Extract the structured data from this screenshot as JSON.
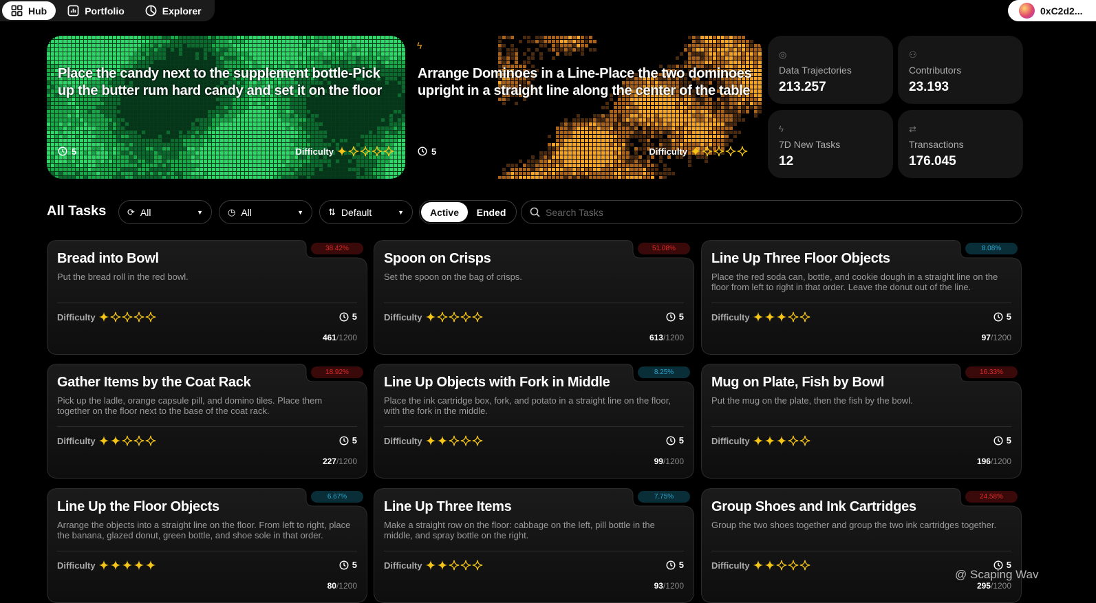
{
  "nav": {
    "tabs": [
      {
        "label": "Hub",
        "active": true
      },
      {
        "label": "Portfolio",
        "active": false
      },
      {
        "label": "Explorer",
        "active": false
      }
    ]
  },
  "wallet": {
    "address": "0xC2d2..."
  },
  "featured": [
    {
      "title": "Place the candy next to the supplement bottle-Pick up the butter rum hard candy and set it on the floor",
      "steps": "5",
      "difficulty_label": "Difficulty",
      "difficulty": 1,
      "accent": "#1ec85a"
    },
    {
      "title": "Arrange Dominoes in a Line-Place the two dominoes upright in a straight line along the center of the table",
      "steps": "5",
      "difficulty_label": "Difficulty",
      "difficulty": 1,
      "accent": "#f0a21e"
    }
  ],
  "stats": [
    {
      "label": "Data Trajectories",
      "value": "213.257",
      "icon": "trajectory-icon"
    },
    {
      "label": "Contributors",
      "value": "23.193",
      "icon": "users-icon"
    },
    {
      "label": "7D New Tasks",
      "value": "12",
      "icon": "bolt-icon"
    },
    {
      "label": "Transactions",
      "value": "176.045",
      "icon": "transfer-icon"
    }
  ],
  "filters": {
    "title": "All Tasks",
    "category": "All",
    "time": "All",
    "sort": "Default",
    "toggle": {
      "active": "Active",
      "ended": "Ended"
    },
    "search_placeholder": "Search Tasks"
  },
  "tasks": [
    {
      "title": "Bread into Bowl",
      "desc": "Put the bread roll in the red bowl.",
      "pct": "38.42%",
      "tone": "red",
      "difficulty": 1,
      "steps": "5",
      "done": "461",
      "total": "/1200"
    },
    {
      "title": "Spoon on Crisps",
      "desc": "Set the spoon on the bag of crisps.",
      "pct": "51.08%",
      "tone": "red",
      "difficulty": 1,
      "steps": "5",
      "done": "613",
      "total": "/1200"
    },
    {
      "title": "Line Up Three Floor Objects",
      "desc": "Place the red soda can, bottle, and cookie dough in a straight line on the floor from left to right in that order. Leave the donut out of the line.",
      "pct": "8.08%",
      "tone": "blue",
      "difficulty": 3,
      "steps": "5",
      "done": "97",
      "total": "/1200"
    },
    {
      "title": "Gather Items by the Coat Rack",
      "desc": "Pick up the ladle, orange capsule pill, and domino tiles. Place them together on the floor next to the base of the coat rack.",
      "pct": "18.92%",
      "tone": "red",
      "difficulty": 2,
      "steps": "5",
      "done": "227",
      "total": "/1200"
    },
    {
      "title": "Line Up Objects with Fork in Middle",
      "desc": "Place the ink cartridge box, fork, and potato in a straight line on the floor, with the fork in the middle.",
      "pct": "8.25%",
      "tone": "blue",
      "difficulty": 2,
      "steps": "5",
      "done": "99",
      "total": "/1200"
    },
    {
      "title": "Mug on Plate, Fish by Bowl",
      "desc": "Put the mug on the plate, then the fish by the bowl.",
      "pct": "16.33%",
      "tone": "red",
      "difficulty": 3,
      "steps": "5",
      "done": "196",
      "total": "/1200"
    },
    {
      "title": "Line Up the Floor Objects",
      "desc": "Arrange the objects into a straight line on the floor. From left to right, place the banana, glazed donut, green bottle, and shoe sole in that order.",
      "pct": "6.67%",
      "tone": "blue",
      "difficulty": 5,
      "steps": "5",
      "done": "80",
      "total": "/1200"
    },
    {
      "title": "Line Up Three Items",
      "desc": "Make a straight row on the floor: cabbage on the left, pill bottle in the middle, and spray bottle on the right.",
      "pct": "7.75%",
      "tone": "blue",
      "difficulty": 2,
      "steps": "5",
      "done": "93",
      "total": "/1200"
    },
    {
      "title": "Group Shoes and Ink Cartridges",
      "desc": "Group the two shoes together and group the two ink cartridges together.",
      "pct": "24.58%",
      "tone": "red",
      "difficulty": 2,
      "steps": "5",
      "done": "295",
      "total": "/1200"
    }
  ],
  "labels": {
    "difficulty": "Difficulty"
  },
  "watermark": "@ Scaping Wav",
  "colors": {
    "star": "#f5c518",
    "page_bg": "#000000",
    "card_bg": "#141414"
  }
}
